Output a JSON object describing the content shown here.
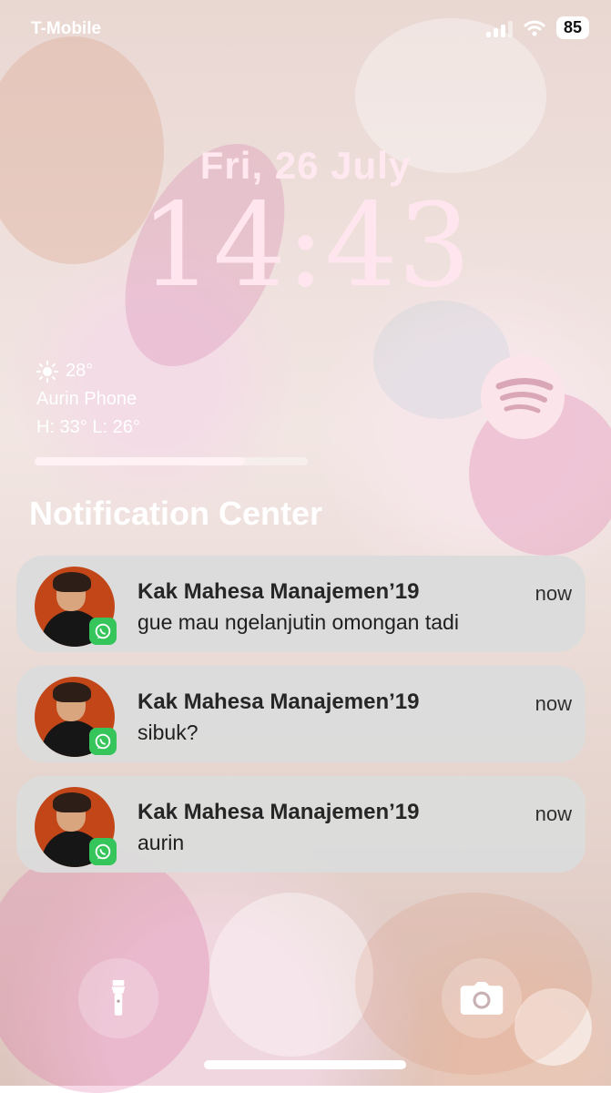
{
  "status_bar": {
    "carrier": "T-Mobile",
    "battery": "85"
  },
  "lockscreen": {
    "date": "Fri, 26 July",
    "time": "14:43"
  },
  "weather": {
    "temperature": "28°",
    "location": "Aurin Phone",
    "high_low": "H: 33° L: 26°"
  },
  "media": {
    "app_icon": "spotify-icon",
    "progress": 0.77
  },
  "notification_center": {
    "title": "Notification Center"
  },
  "notifications": [
    {
      "sender": "Kak Mahesa Manajemen’19",
      "message": "gue mau ngelanjutin omongan tadi",
      "time": "now",
      "app_icon": "whatsapp-icon"
    },
    {
      "sender": "Kak Mahesa Manajemen’19",
      "message": "sibuk?",
      "time": "now",
      "app_icon": "whatsapp-icon"
    },
    {
      "sender": "Kak Mahesa Manajemen’19",
      "message": "aurin",
      "time": "now",
      "app_icon": "whatsapp-icon"
    }
  ],
  "quick_actions": {
    "left_icon": "flashlight-icon",
    "right_icon": "camera-icon"
  },
  "colors": {
    "accent": "#ffe6ee",
    "notification_bg": "#dcdcdc",
    "whatsapp": "#35c55a",
    "spotify_badge": "#fbe5ea"
  }
}
